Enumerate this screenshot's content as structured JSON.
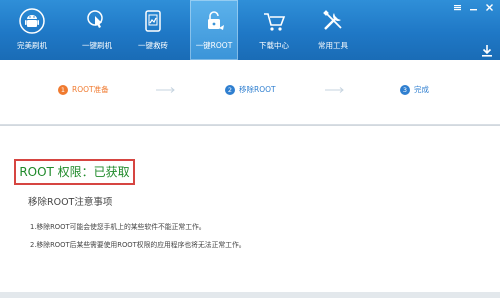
{
  "toolbar": {
    "items": [
      {
        "label": "完美刷机",
        "icon": "android-icon"
      },
      {
        "label": "一键刷机",
        "icon": "touch-phone-icon"
      },
      {
        "label": "一键救砖",
        "icon": "phone-rescue-icon"
      },
      {
        "label": "一键ROOT",
        "icon": "lock-icon"
      },
      {
        "label": "下载中心",
        "icon": "cart-icon"
      },
      {
        "label": "常用工具",
        "icon": "tools-icon"
      }
    ],
    "active_index": 3,
    "colors": {
      "bar": "#1f78c6",
      "active": "#4aa3e3"
    }
  },
  "window": {
    "buttons": [
      "settings-icon",
      "minimize-icon",
      "close-icon"
    ]
  },
  "steps": {
    "items": [
      {
        "num": "1",
        "label": "ROOT准备",
        "color": "#f07a2f"
      },
      {
        "num": "2",
        "label": "移除ROOT",
        "color": "#2f7fd0"
      },
      {
        "num": "3",
        "label": "完成",
        "color": "#2f7fd0"
      }
    ]
  },
  "main": {
    "root_status": "ROOT 权限：已获取",
    "notice_title": "移除ROOT注意事项",
    "notices": [
      "1.移除ROOT可能会使您手机上的某些软件不能正常工作。",
      "2.移除ROOT后某些需要使用ROOT权限的应用程序也将无法正常工作。"
    ]
  }
}
